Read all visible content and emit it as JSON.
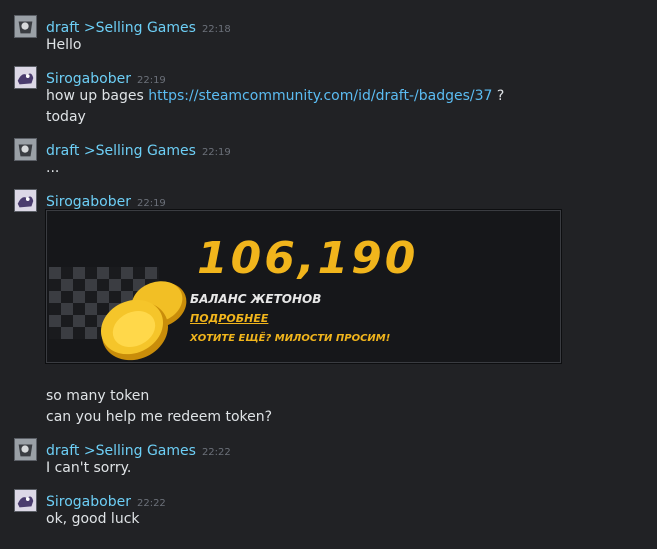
{
  "users": {
    "draft": "draft >Selling Games",
    "siro": "Sirogabober"
  },
  "messages": [
    {
      "time": "22:18",
      "lines": [
        "Hello"
      ]
    },
    {
      "time": "22:19",
      "line_prefix": "how up bages ",
      "link": "https://steamcommunity.com/id/draft-/badges/37",
      "line_suffix": " ?",
      "lines": [
        "today"
      ]
    },
    {
      "time": "22:19",
      "lines": [
        "..."
      ]
    },
    {
      "time": "22:19",
      "lines": [
        "so many token",
        "can you help me redeem token?"
      ]
    },
    {
      "time": "22:22",
      "lines": [
        "I can't sorry."
      ]
    },
    {
      "time": "22:22",
      "lines": [
        "ok, good luck"
      ]
    }
  ],
  "embed": {
    "amount": "106,190",
    "title": "БАЛАНС ЖЕТОНОВ",
    "more": "ПОДРОБНЕЕ",
    "cta": "ХОТИТЕ ЕЩЁ? МИЛОСТИ ПРОСИМ!"
  },
  "colors": {
    "background": "#212225",
    "name": "#6dcff6",
    "link": "#5bbcf2",
    "accent": "#f1b51c"
  }
}
